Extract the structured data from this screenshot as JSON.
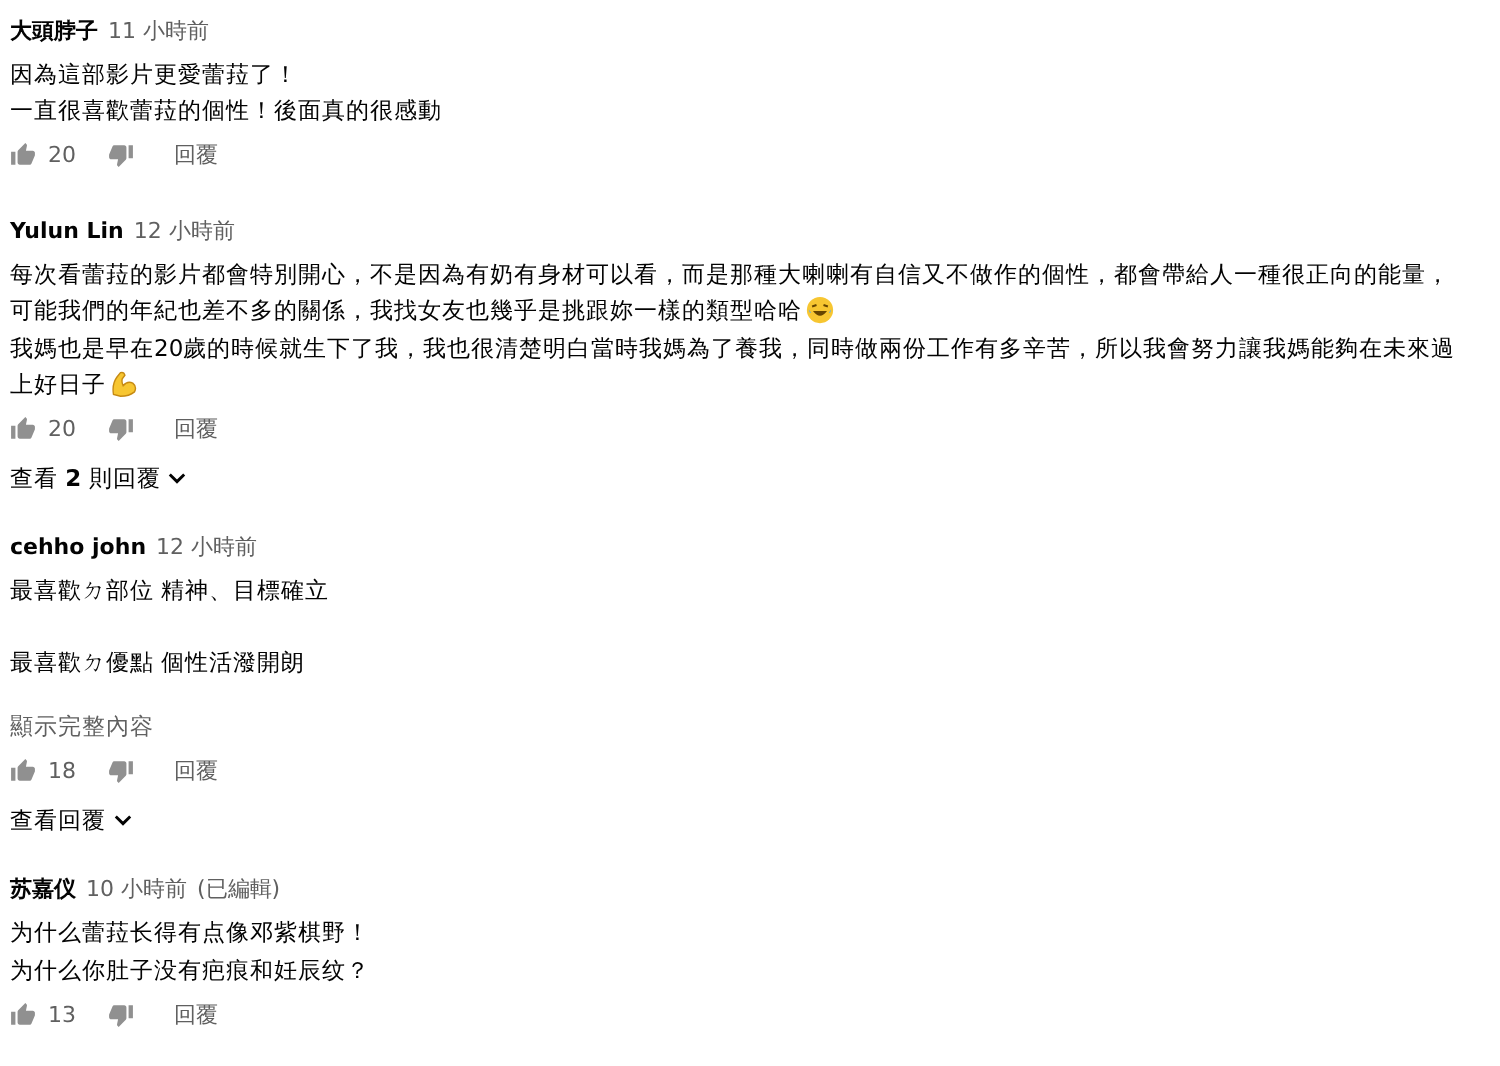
{
  "comments": [
    {
      "author": "大頭脖子",
      "time": "11 小時前",
      "paragraphs": [
        [
          {
            "text": "因為這部影片更愛蕾菈了！"
          },
          {
            "text": "一直很喜歡蕾菈的個性！後面真的很感動"
          }
        ]
      ],
      "likes": "20",
      "reply": "回覆"
    },
    {
      "author": "Yulun Lin",
      "time": "12 小時前",
      "paragraphs": [
        [
          {
            "text": "每次看蕾菈的影片都會特別開心，不是因為有奶有身材可以看，而是那種大喇喇有自信又不做作的個性，都會帶給人一種很正向的能量，"
          },
          {
            "text": "可能我們的年紀也差不多的關係，我找女友也幾乎是挑跟妳一樣的類型哈哈",
            "icon": {
              "kind": "laugh"
            }
          },
          {
            "text": "我媽也是早在20歲的時候就生下了我，我也很清楚明白當時我媽為了養我，同時做兩份工作有多辛苦，所以我會努力讓我媽能夠在未來過"
          },
          {
            "text": "上好日子",
            "icon": {
              "kind": "muscle"
            }
          }
        ]
      ],
      "likes": "20",
      "reply": "回覆",
      "replies": "查看 **2** 則回覆"
    },
    {
      "author": "cehho john",
      "time": "12 小時前",
      "paragraphs": [
        [
          {
            "text": "最喜歡ㄉ部位 精神、目標確立"
          }
        ],
        [
          {
            "text": "最喜歡ㄉ優點 個性活潑開朗"
          }
        ]
      ],
      "more": "顯示完整內容",
      "likes": "18",
      "reply": "回覆",
      "replies": "查看回覆"
    },
    {
      "author": "苏嘉仪",
      "time": "10 小時前",
      "edited": "(已編輯)",
      "paragraphs": [
        [
          {
            "text": "为什么蕾菈长得有点像邓紫棋野！"
          },
          {
            "text": "为什么你肚子没有疤痕和妊辰纹？"
          }
        ]
      ],
      "likes": "13",
      "reply": "回覆"
    }
  ]
}
